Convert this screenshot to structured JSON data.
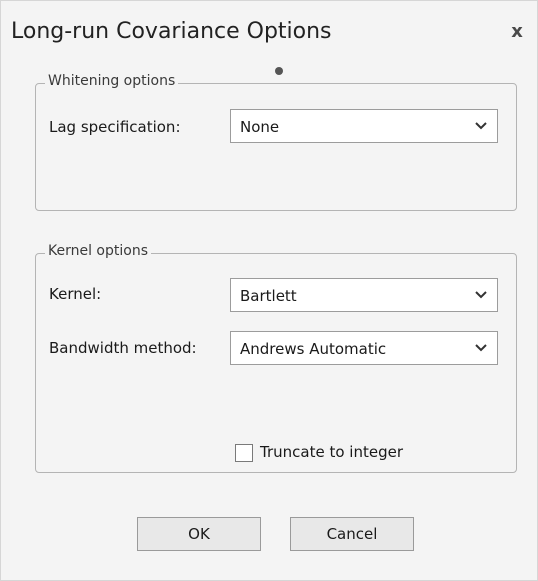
{
  "window": {
    "title": "Long-run Covariance Options",
    "close_glyph": "x"
  },
  "whitening": {
    "legend": "Whitening options",
    "lag_label": "Lag specification:",
    "lag_value": "None"
  },
  "kernel": {
    "legend": "Kernel options",
    "kernel_label": "Kernel:",
    "kernel_value": "Bartlett",
    "bandwidth_label": "Bandwidth method:",
    "bandwidth_value": "Andrews Automatic",
    "truncate_label": "Truncate to integer",
    "truncate_checked": false
  },
  "buttons": {
    "ok_label": "OK",
    "cancel_label": "Cancel"
  },
  "icons": {
    "close": "close-icon",
    "dropdown": "chevron-down-icon"
  },
  "colors": {
    "background": "#f4f4f4",
    "border": "#b4b4b4",
    "field": "#ffffff"
  }
}
